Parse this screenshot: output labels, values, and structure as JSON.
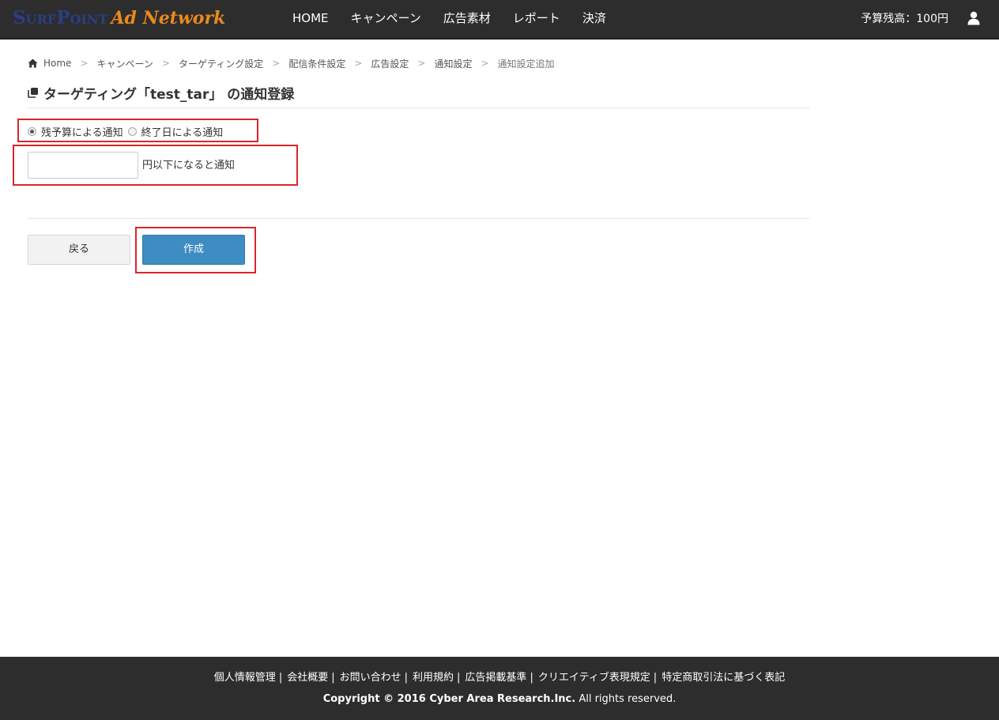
{
  "header": {
    "logo_part1": "SurfPoint",
    "logo_part2": "Ad Network",
    "nav": [
      "HOME",
      "キャンペーン",
      "広告素材",
      "レポート",
      "決済"
    ],
    "budget": "予算残高：100円",
    "user_icon": "user-icon"
  },
  "breadcrumb": {
    "items": [
      "Home",
      "キャンペーン",
      "ターゲティング設定",
      "配信条件設定",
      "広告設定",
      "通知設定",
      "通知設定追加"
    ],
    "separator": ">"
  },
  "page": {
    "title": "ターゲティング「test_tar」 の通知登録"
  },
  "form": {
    "radio_options": [
      {
        "label": "残予算による通知",
        "checked": true
      },
      {
        "label": "終了日による通知",
        "checked": false
      }
    ],
    "amount_value": "",
    "amount_placeholder": "",
    "amount_suffix": "円以下になると通知"
  },
  "buttons": {
    "back_label": "戻る",
    "create_label": "作成"
  },
  "footer": {
    "links": [
      "個人情報管理",
      "会社概要",
      "お問い合わせ",
      "利用規約",
      "広告掲載基準",
      "クリエイティブ表現規定",
      "特定商取引法に基づく表記"
    ],
    "separator": "|",
    "copyright_bold": "Copyright © 2016 Cyber Area Research.Inc.",
    "copyright_rest": " All rights reserved."
  },
  "colors": {
    "navbar_bg": "#2d2d2d",
    "accent_blue": "#3d8cc2",
    "highlight_red": "#d9252b",
    "logo_blue": "#2a3f87",
    "logo_orange": "#e98a1d"
  }
}
